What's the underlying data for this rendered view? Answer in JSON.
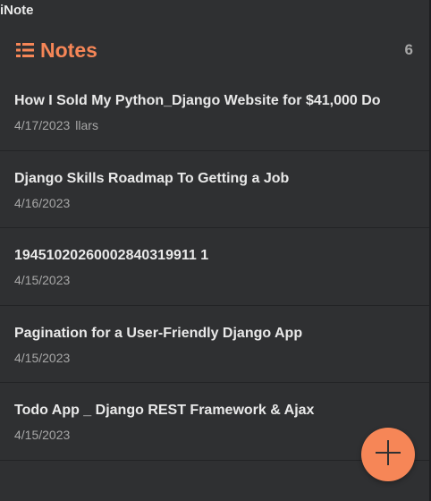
{
  "app": {
    "title": "iNote"
  },
  "header": {
    "title": "Notes",
    "count": "6",
    "icon": "list-icon"
  },
  "notes": [
    {
      "title": "How I Sold My Python_Django Website for $41,000 Do",
      "date": "4/17/2023",
      "preview": "llars"
    },
    {
      "title": "Django Skills Roadmap To Getting a Job",
      "date": "4/16/2023",
      "preview": ""
    },
    {
      "title": "19451020260002840319911 1",
      "date": "4/15/2023",
      "preview": ""
    },
    {
      "title": "Pagination for a User-Friendly Django App",
      "date": "4/15/2023",
      "preview": ""
    },
    {
      "title": "Todo App _ Django REST Framework & Ajax",
      "date": "4/15/2023",
      "preview": ""
    }
  ],
  "fab": {
    "icon": "plus-icon"
  },
  "colors": {
    "accent": "#f68657",
    "background": "#2f3032",
    "text": "#e9e9e9",
    "muted": "#a7a7a7"
  }
}
